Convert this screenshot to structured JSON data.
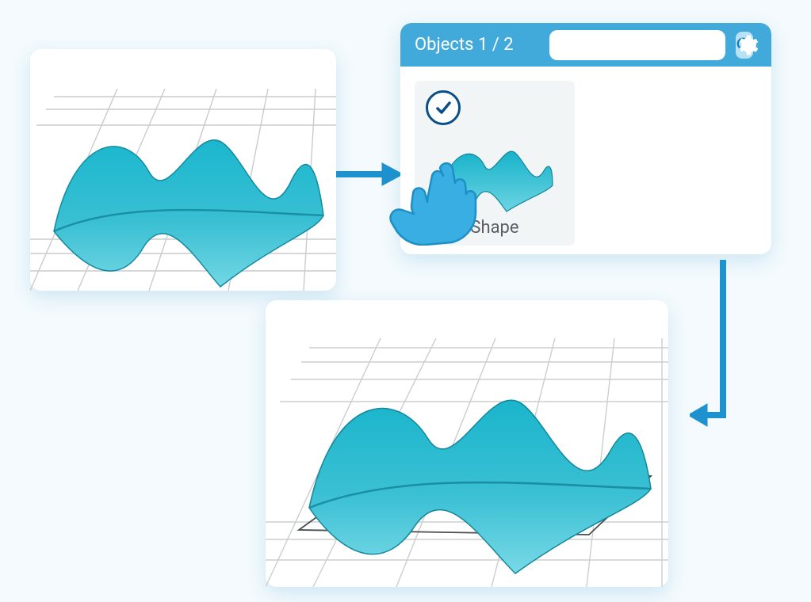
{
  "colors": {
    "accent": "#42aadb",
    "accent_dark": "#1e92cf",
    "check_border": "#0a4e8a",
    "surface": "#1fb3c9",
    "surface_dark": "#148aa0",
    "bg": "#f5fafd"
  },
  "objects_panel": {
    "title": "Objects 1 / 2",
    "search_placeholder": "",
    "item_label": "Shape"
  },
  "steps": {
    "source": "3d-shape-original",
    "select": "select-shape-in-objects-panel",
    "result": "3d-shape-selected-outline"
  }
}
